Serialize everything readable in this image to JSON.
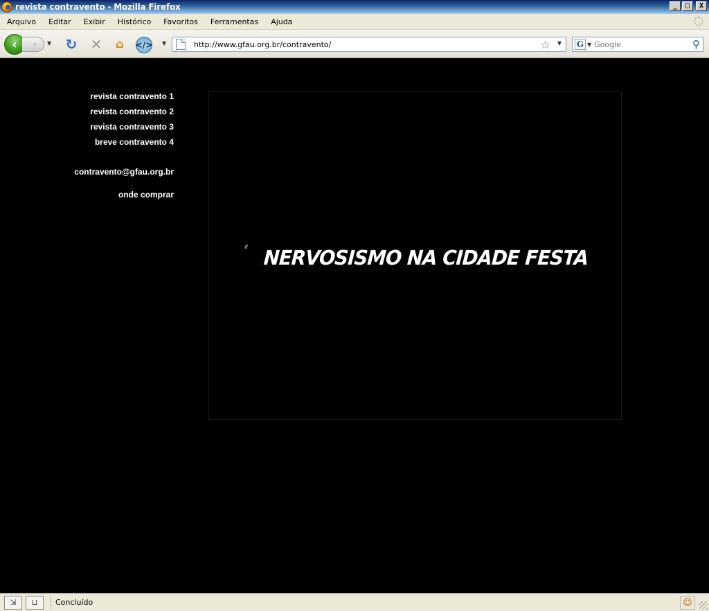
{
  "window": {
    "title": "revista contravento - Mozilla Firefox",
    "buttons": {
      "minimize": "_",
      "maximize": "□",
      "close": "X"
    }
  },
  "menu": {
    "items": [
      "Arquivo",
      "Editar",
      "Exibir",
      "Histórico",
      "Favoritos",
      "Ferramentas",
      "Ajuda"
    ]
  },
  "toolbar": {
    "url": "http://www.gfau.org.br/contravento/",
    "search_placeholder": "Google",
    "search_engine_letter": "G"
  },
  "page": {
    "nav": [
      "revista contravento 1",
      "revista contravento 2",
      "revista contravento 3",
      "breve contravento 4"
    ],
    "email": "contravento@gfau.org.br",
    "buy_link": "onde comprar",
    "headline": "NERVOSISMO NA CIDADE FESTA"
  },
  "status": {
    "text": "Concluído"
  },
  "icons": {
    "back": "back-arrow-icon",
    "forward": "forward-arrow-icon",
    "reload": "reload-icon",
    "stop": "stop-icon",
    "home": "home-icon",
    "star": "bookmark-star-icon",
    "search": "magnifier-icon"
  }
}
